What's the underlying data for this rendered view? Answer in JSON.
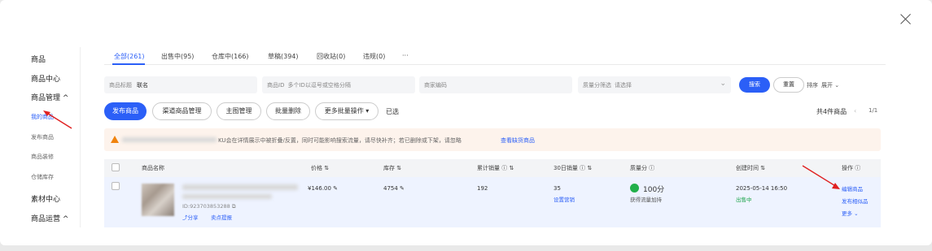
{
  "close_label": "×",
  "sidebar": {
    "items": [
      {
        "label": "商品",
        "kind": "main"
      },
      {
        "label": "商品中心",
        "kind": "main"
      },
      {
        "label": "商品管理 ^",
        "kind": "main"
      },
      {
        "label": "我的商品",
        "kind": "sub-active"
      },
      {
        "label": "发布商品",
        "kind": "sub"
      },
      {
        "label": "商品装修",
        "kind": "sub"
      },
      {
        "label": "仓储库存",
        "kind": "sub"
      },
      {
        "label": "素材中心",
        "kind": "main"
      },
      {
        "label": "商品运营 ^",
        "kind": "main"
      }
    ]
  },
  "tabs": [
    {
      "label": "全部(261)",
      "active": true
    },
    {
      "label": "出售中(95)"
    },
    {
      "label": "仓库中(166)"
    },
    {
      "label": "草稿(394)"
    },
    {
      "label": "回收站(0)"
    },
    {
      "label": "违规(0)"
    },
    {
      "label": "···"
    }
  ],
  "filters": {
    "title": {
      "label": "商品标题",
      "value": "联名"
    },
    "id": {
      "label": "商品ID",
      "placeholder": "多个ID以逗号或空格分隔"
    },
    "code": {
      "placeholder": "商家编码"
    },
    "quality": {
      "label": "质量分筛选",
      "placeholder": "请选择"
    },
    "search_label": "搜索",
    "reset_label": "重置",
    "sort_label": "排序",
    "expand_label": "展开"
  },
  "actions": {
    "publish": "发布商品",
    "channel": "渠道商品管理",
    "main_image": "主图管理",
    "batch_delete": "批量删除",
    "more_batch": "更多批量操作",
    "selected": "已选",
    "total": "共4件商品",
    "page": "1/1"
  },
  "notice": {
    "text": "KU会在详情展示中被折叠/反置，同时可能影响搜索流量，请尽快补齐；若已删除或下架，请忽略",
    "link": "查看缺货商品"
  },
  "table": {
    "headers": [
      "商品名称",
      "价格",
      "库存",
      "累计销量",
      "30日销量",
      "质量分",
      "创建时间",
      "操作"
    ],
    "rows": [
      {
        "id": "ID:923703853288",
        "share": "分享",
        "sell_guide": "卖点提报",
        "price": "¥146.00",
        "stock": "4754",
        "total_sales": "192",
        "sales_30d": "35",
        "set_marketing": "设置营销",
        "quality_score": "100分",
        "quality_note": "获得流量加持",
        "created": "2025-05-14 16:50",
        "status": "出售中",
        "op_edit": "编辑商品",
        "op_similar": "发布相似品",
        "op_more": "更多"
      }
    ]
  },
  "colors": {
    "accent": "#2b5ff7",
    "status_green": "#1aa34a",
    "annotation": "#e02020"
  }
}
